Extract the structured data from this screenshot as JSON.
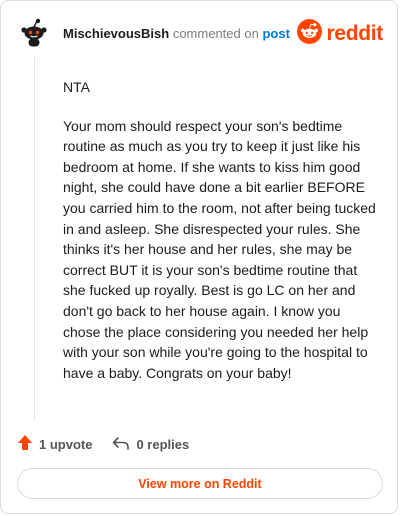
{
  "header": {
    "username": "MischievousBish",
    "action_text": "commented on",
    "post_link": "post",
    "brand": "reddit"
  },
  "comment": {
    "paragraphs": [
      "NTA",
      "Your mom should respect your son's bedtime routine as much as you try to keep it just like his bedroom at home. If she wants to kiss him good night, she could have done a bit earlier BEFORE you carried him to the room, not after being tucked in and asleep. She disrespected your rules. She thinks it's her house and her rules, she may be correct BUT it is your son's bedtime routine that she fucked up royally. Best is go LC on her and don't go back to her house again. I know you chose the place considering you needed her help with your son while you're going to the hospital to have a baby. Congrats on your baby!"
    ]
  },
  "actions": {
    "upvote_label": "1 upvote",
    "replies_label": "0 replies"
  },
  "cta": {
    "label": "View more on Reddit"
  },
  "colors": {
    "brand_orange": "#ff4500",
    "link_blue": "#0079d3"
  },
  "icons": {
    "avatar": "snoo-avatar-icon",
    "brand": "reddit-logo-icon",
    "upvote": "upvote-arrow-icon",
    "reply": "reply-arrow-icon"
  }
}
